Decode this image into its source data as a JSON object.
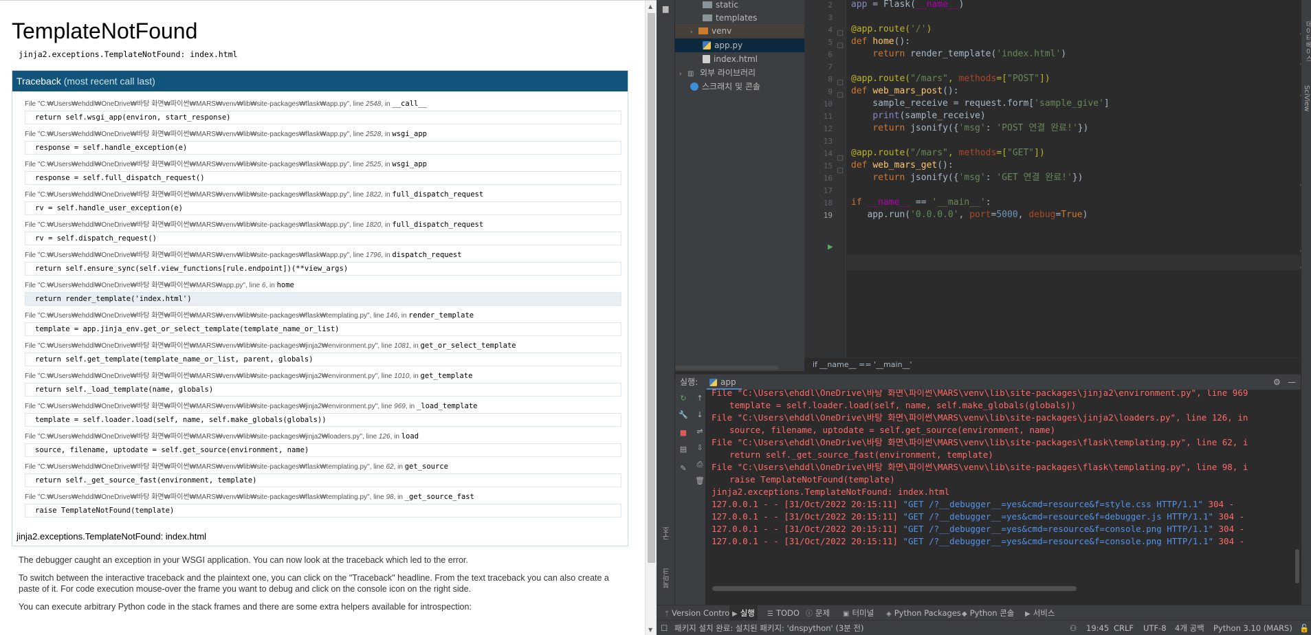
{
  "debugger": {
    "title": "TemplateNotFound",
    "subtitle": "jinja2.exceptions.TemplateNotFound: index.html",
    "traceback_header": "Traceback",
    "traceback_header_note": "(most recent call last)",
    "frames": [
      {
        "file_prefix": "File \"C:₩Users₩ehddl₩OneDrive₩바탕 화면₩파이썬₩MARS₩venv₩lib₩site-packages₩flask₩app.py\", line ",
        "line": "2548",
        "in": ", in ",
        "func": "__call__",
        "code": "return self.wsgi_app(environ, start_response)"
      },
      {
        "file_prefix": "File \"C:₩Users₩ehddl₩OneDrive₩바탕 화면₩파이썬₩MARS₩venv₩lib₩site-packages₩flask₩app.py\", line ",
        "line": "2528",
        "in": ", in ",
        "func": "wsgi_app",
        "code": "response = self.handle_exception(e)"
      },
      {
        "file_prefix": "File \"C:₩Users₩ehddl₩OneDrive₩바탕 화면₩파이썬₩MARS₩venv₩lib₩site-packages₩flask₩app.py\", line ",
        "line": "2525",
        "in": ", in ",
        "func": "wsgi_app",
        "code": "response = self.full_dispatch_request()"
      },
      {
        "file_prefix": "File \"C:₩Users₩ehddl₩OneDrive₩바탕 화면₩파이썬₩MARS₩venv₩lib₩site-packages₩flask₩app.py\", line ",
        "line": "1822",
        "in": ", in ",
        "func": "full_dispatch_request",
        "code": "rv = self.handle_user_exception(e)"
      },
      {
        "file_prefix": "File \"C:₩Users₩ehddl₩OneDrive₩바탕 화면₩파이썬₩MARS₩venv₩lib₩site-packages₩flask₩app.py\", line ",
        "line": "1820",
        "in": ", in ",
        "func": "full_dispatch_request",
        "code": "rv = self.dispatch_request()"
      },
      {
        "file_prefix": "File \"C:₩Users₩ehddl₩OneDrive₩바탕 화면₩파이썬₩MARS₩venv₩lib₩site-packages₩flask₩app.py\", line ",
        "line": "1796",
        "in": ", in ",
        "func": "dispatch_request",
        "code": "return self.ensure_sync(self.view_functions[rule.endpoint])(**view_args)"
      },
      {
        "file_prefix": "File \"C:₩Users₩ehddl₩OneDrive₩바탕 화면₩파이썬₩MARS₩app.py\", line ",
        "line": "6",
        "in": ", in ",
        "func": "home",
        "code": "return render_template('index.html')",
        "current": true
      },
      {
        "file_prefix": "File \"C:₩Users₩ehddl₩OneDrive₩바탕 화면₩파이썬₩MARS₩venv₩lib₩site-packages₩flask₩templating.py\", line ",
        "line": "146",
        "in": ", in ",
        "func": "render_template",
        "code": "template = app.jinja_env.get_or_select_template(template_name_or_list)"
      },
      {
        "file_prefix": "File \"C:₩Users₩ehddl₩OneDrive₩바탕 화면₩파이썬₩MARS₩venv₩lib₩site-packages₩jinja2₩environment.py\", line ",
        "line": "1081",
        "in": ", in ",
        "func": "get_or_select_template",
        "code": "return self.get_template(template_name_or_list, parent, globals)"
      },
      {
        "file_prefix": "File \"C:₩Users₩ehddl₩OneDrive₩바탕 화면₩파이썬₩MARS₩venv₩lib₩site-packages₩jinja2₩environment.py\", line ",
        "line": "1010",
        "in": ", in ",
        "func": "get_template",
        "code": "return self._load_template(name, globals)"
      },
      {
        "file_prefix": "File \"C:₩Users₩ehddl₩OneDrive₩바탕 화면₩파이썬₩MARS₩venv₩lib₩site-packages₩jinja2₩environment.py\", line ",
        "line": "969",
        "in": ", in ",
        "func": "_load_template",
        "code": "template = self.loader.load(self, name, self.make_globals(globals))"
      },
      {
        "file_prefix": "File \"C:₩Users₩ehddl₩OneDrive₩바탕 화면₩파이썬₩MARS₩venv₩lib₩site-packages₩jinja2₩loaders.py\", line ",
        "line": "126",
        "in": ", in ",
        "func": "load",
        "code": "source, filename, uptodate = self.get_source(environment, name)"
      },
      {
        "file_prefix": "File \"C:₩Users₩ehddl₩OneDrive₩바탕 화면₩파이썬₩MARS₩venv₩lib₩site-packages₩flask₩templating.py\", line ",
        "line": "62",
        "in": ", in ",
        "func": "get_source",
        "code": "return self._get_source_fast(environment, template)"
      },
      {
        "file_prefix": "File \"C:₩Users₩ehddl₩OneDrive₩바탕 화면₩파이썬₩MARS₩venv₩lib₩site-packages₩flask₩templating.py\", line ",
        "line": "98",
        "in": ", in ",
        "func": "_get_source_fast",
        "code": "raise TemplateNotFound(template)"
      }
    ],
    "footer_exception": "jinja2.exceptions.TemplateNotFound: index.html",
    "paragraphs": [
      "The debugger caught an exception in your WSGI application. You can now look at the traceback which led to the error.",
      "To switch between the interactive traceback and the plaintext one, you can click on the \"Traceback\" headline. From the text traceback you can also create a paste of it. For code execution mouse-over the frame you want to debug and click on the console icon on the right side.",
      "You can execute arbitrary Python code in the stack frames and there are some extra helpers available for introspection:"
    ]
  },
  "project_tree": {
    "items": [
      {
        "label": "static",
        "icon": "folder-icon"
      },
      {
        "label": "templates",
        "icon": "folder-icon"
      },
      {
        "label": "venv",
        "icon": "folder-icon"
      },
      {
        "label": "app.py",
        "icon": "python-file-icon"
      },
      {
        "label": "index.html",
        "icon": "html-file-icon"
      },
      {
        "label": "외부 라이브러리",
        "icon": "library-icon"
      },
      {
        "label": "스크래치 및 콘솔",
        "icon": "scratch-icon"
      }
    ]
  },
  "editor": {
    "line_numbers": [
      "2",
      "3",
      "4",
      "5",
      "6",
      "7",
      "8",
      "9",
      "10",
      "11",
      "12",
      "13",
      "14",
      "15",
      "16",
      "17",
      "18",
      "19"
    ],
    "breadcrumb": "if __name__ == '__main__'"
  },
  "run_panel": {
    "label": "실행:",
    "tab": "app",
    "console_lines": [
      {
        "text": "File \"C:\\Users\\ehddl\\OneDrive\\바탕 화면\\파이썬\\MARS\\venv\\lib\\site-packages\\jinja2\\environment.py\", line 969",
        "indent": false
      },
      {
        "text": "template = self.loader.load(self, name, self.make_globals(globals))",
        "indent": true
      },
      {
        "text": "File \"C:\\Users\\ehddl\\OneDrive\\바탕 화면\\파이썬\\MARS\\venv\\lib\\site-packages\\jinja2\\loaders.py\", line 126, in",
        "indent": false
      },
      {
        "text": "source, filename, uptodate = self.get_source(environment, name)",
        "indent": true
      },
      {
        "text": "File \"C:\\Users\\ehddl\\OneDrive\\바탕 화면\\파이썬\\MARS\\venv\\lib\\site-packages\\flask\\templating.py\", line 62, i",
        "indent": false
      },
      {
        "text": "return self._get_source_fast(environment, template)",
        "indent": true
      },
      {
        "text": "File \"C:\\Users\\ehddl\\OneDrive\\바탕 화면\\파이썬\\MARS\\venv\\lib\\site-packages\\flask\\templating.py\", line 98, i",
        "indent": false
      },
      {
        "text": "raise TemplateNotFound(template)",
        "indent": true
      },
      {
        "text": "jinja2.exceptions.TemplateNotFound: index.html",
        "indent": false,
        "head": true
      },
      {
        "text": "127.0.0.1 - - [31/Oct/2022 20:15:11] ",
        "link": "\"GET /?__debugger__=yes&cmd=resource&f=style.css HTTP/1.1\"",
        "tail": " 304 -",
        "indent": false,
        "head": true
      },
      {
        "text": "127.0.0.1 - - [31/Oct/2022 20:15:11] ",
        "link": "\"GET /?__debugger__=yes&cmd=resource&f=debugger.js HTTP/1.1\"",
        "tail": " 304 -",
        "indent": false,
        "head": true
      },
      {
        "text": "127.0.0.1 - - [31/Oct/2022 20:15:11] ",
        "link": "\"GET /?__debugger__=yes&cmd=resource&f=console.png HTTP/1.1\"",
        "tail": " 304 -",
        "indent": false,
        "head": true
      },
      {
        "text": "127.0.0.1 - - [31/Oct/2022 20:15:11] ",
        "link": "\"GET /?__debugger__=yes&cmd=resource&f=console.png HTTP/1.1\"",
        "tail": " 304 -",
        "indent": false,
        "head": true
      }
    ]
  },
  "bottom_tabs": [
    "Version Control",
    "실행",
    "TODO",
    "문제",
    "터미널",
    "Python Packages",
    "Python 콘솔",
    "서비스"
  ],
  "status_bar": {
    "message": "패키지 설치 완료: 설치된 패키지: 'dnspython' (3분 전)",
    "position": "19:45",
    "line_sep": "CRLF",
    "encoding": "UTF-8",
    "indent": "4개 공백",
    "interpreter": "Python 3.10 (MARS)"
  },
  "side_labels": {
    "left_structure": "구조",
    "left_bookmarks": "북마크",
    "right_database": "데이터베이스",
    "right_sciview": "SciView"
  },
  "colors": {
    "traceback_header": "#11557c",
    "ide_background": "#2b2b2b",
    "console_error": "#ff6b68",
    "console_link": "#5394ec"
  }
}
